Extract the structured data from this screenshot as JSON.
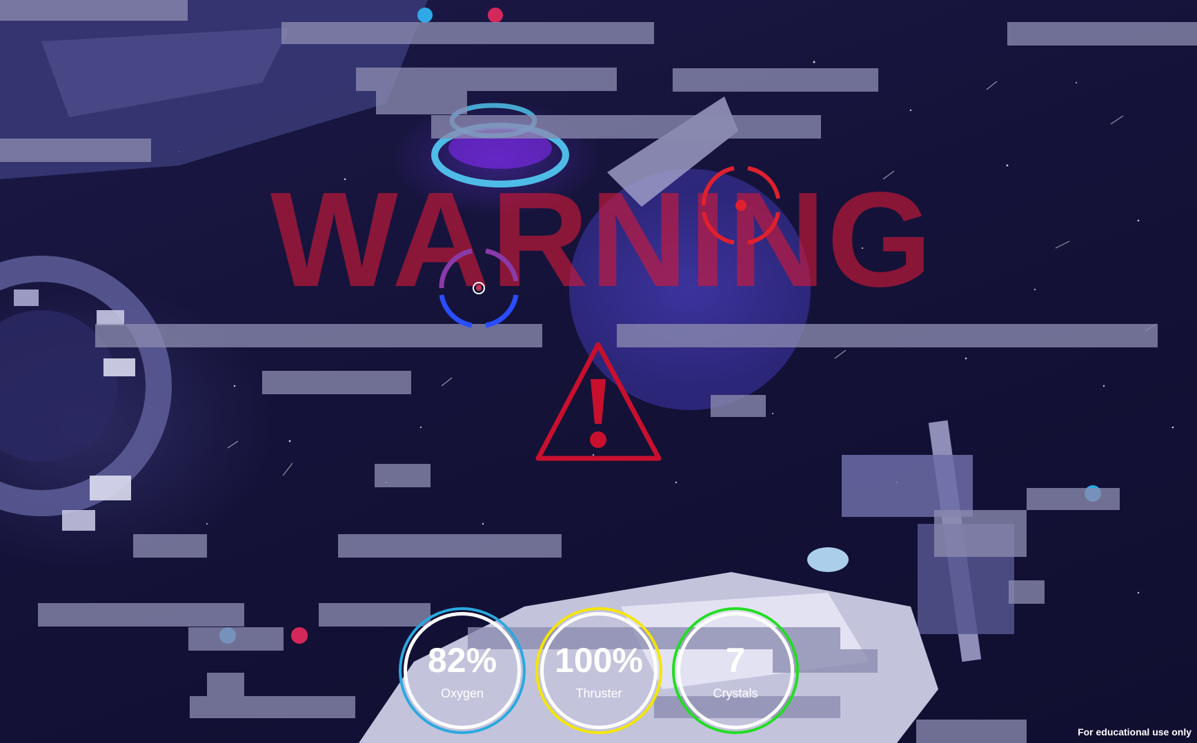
{
  "hud": {
    "warning_text": "WARNING",
    "warning_icon": "warning-triangle-icon",
    "warning_color": "#d21937"
  },
  "reticles": [
    {
      "name": "enemy-target-reticle",
      "color": "#e0202e"
    },
    {
      "name": "player-aim-reticle",
      "color": "#2a4dff"
    }
  ],
  "stats": [
    {
      "id": "oxygen",
      "value": "82%",
      "label": "Oxygen",
      "ring_color": "#29a9e0"
    },
    {
      "id": "thruster",
      "value": "100%",
      "label": "Thruster",
      "ring_color": "#f5e600"
    },
    {
      "id": "crystals",
      "value": "7",
      "label": "Crystals",
      "ring_color": "#22dd22"
    }
  ],
  "footer": {
    "note": "For educational use only"
  }
}
